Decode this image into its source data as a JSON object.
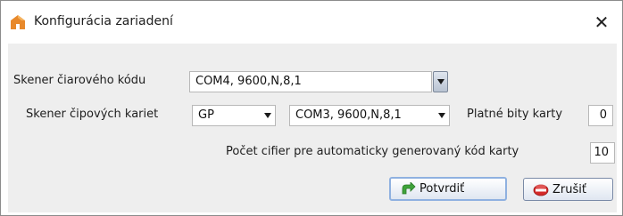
{
  "window": {
    "title": "Konfigurácia zariadení",
    "close_glyph": "✕"
  },
  "barcode_scanner": {
    "label": "Skener čiarového kódu",
    "value": "COM4, 9600,N,8,1"
  },
  "chip_scanner": {
    "label": "Skener čipových kariet",
    "type_value": "GP",
    "port_value": "COM3, 9600,N,8,1"
  },
  "valid_bits": {
    "label": "Platné bity karty",
    "value": "0"
  },
  "digit_count": {
    "label": "Počet cifier pre automaticky generovaný kód karty",
    "value": "10"
  },
  "buttons": {
    "confirm_label": "Potvrdiť",
    "cancel_label": "Zrušiť"
  },
  "icons": {
    "app": "house-logo-icon",
    "confirm": "green-arrow-icon",
    "cancel": "red-stop-icon"
  },
  "colors": {
    "accent_orange": "#e8892b",
    "confirm_green": "#3ea33a",
    "cancel_red": "#d42a2a"
  }
}
